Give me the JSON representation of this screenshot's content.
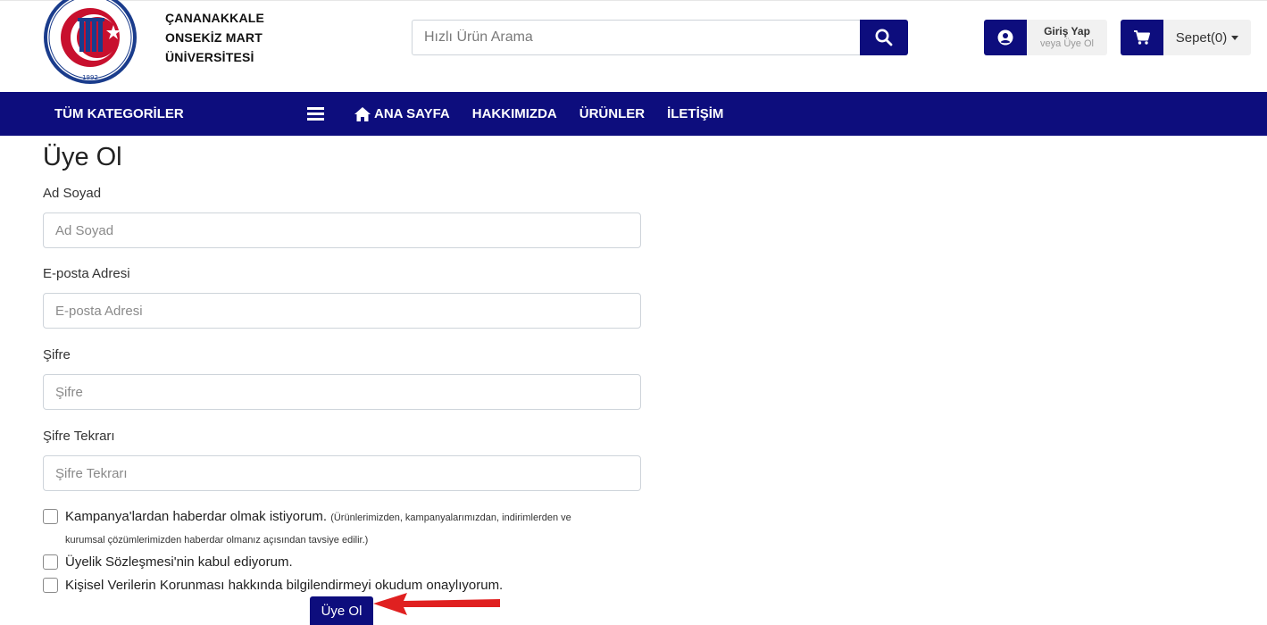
{
  "brand": {
    "line1": "ÇANANAKKALE",
    "line2": "ONSEKİZ MART",
    "line3": "ÜNİVERSİTESİ",
    "logo_text": "ÇANAKKALE ONSEKİZ MART ÜNİVERSİTESİ",
    "logo_year": "1992"
  },
  "search": {
    "placeholder": "Hızlı Ürün Arama",
    "icon": "search-icon"
  },
  "account": {
    "main": "Giriş Yap",
    "sub": "veya Üye Ol",
    "icon": "user-circle-icon"
  },
  "cart": {
    "label": "Sepet(0)",
    "icon": "cart-icon"
  },
  "nav": {
    "categories": "TÜM KATEGORİLER",
    "links": [
      "ANA SAYFA",
      "HAKKIMIZDA",
      "ÜRÜNLER",
      "İLETİŞİM"
    ]
  },
  "form": {
    "title": "Üye Ol",
    "fields": [
      {
        "label": "Ad Soyad",
        "placeholder": "Ad Soyad",
        "value": ""
      },
      {
        "label": "E-posta Adresi",
        "placeholder": "E-posta Adresi",
        "value": ""
      },
      {
        "label": "Şifre",
        "placeholder": "Şifre",
        "value": ""
      },
      {
        "label": "Şifre Tekrarı",
        "placeholder": "Şifre Tekrarı",
        "value": ""
      }
    ],
    "checks": [
      {
        "link": "Kampanya",
        "text": "'lardan haberdar olmak istiyorum.",
        "note": "(Ürünlerimizden, kampanyalarımızdan, indirimlerden ve",
        "note2": "kurumsal çözümlerimizden haberdar olmanız açısından tavsiye edilir.)",
        "checked": false
      },
      {
        "link": "Üyelik Sözleşmesi",
        "text": "'nin kabul ediyorum.",
        "checked": false
      },
      {
        "link": "Kişisel Verilerin Korunması",
        "text": " hakkında bilgilendirmeyi okudum onaylıyorum.",
        "checked": false
      }
    ],
    "submit": "Üye Ol"
  },
  "colors": {
    "primary": "#0d0d7d",
    "arrow": "#e02020",
    "logo_red": "#c8102e",
    "logo_blue": "#1a3c8c"
  }
}
